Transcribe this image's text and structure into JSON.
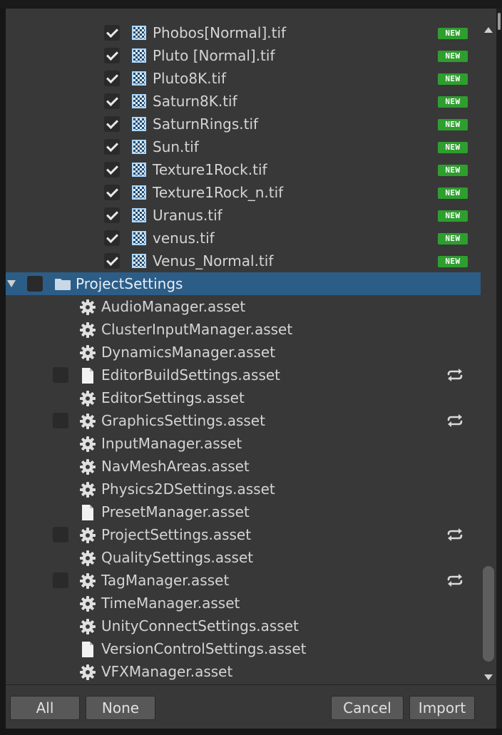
{
  "files_new": [
    {
      "label": "Phobos[Normal].tif",
      "checked": true
    },
    {
      "label": "Pluto [Normal].tif",
      "checked": true
    },
    {
      "label": "Pluto8K.tif",
      "checked": true
    },
    {
      "label": "Saturn8K.tif",
      "checked": true
    },
    {
      "label": "SaturnRings.tif",
      "checked": true
    },
    {
      "label": "Sun.tif",
      "checked": true
    },
    {
      "label": "Texture1Rock.tif",
      "checked": true
    },
    {
      "label": "Texture1Rock_n.tif",
      "checked": true
    },
    {
      "label": "Uranus.tif",
      "checked": true
    },
    {
      "label": "venus.tif",
      "checked": true
    },
    {
      "label": "Venus_Normal.tif",
      "checked": true
    }
  ],
  "badge_label": "NEW",
  "folder": {
    "label": "ProjectSettings",
    "checked": false,
    "expanded": true
  },
  "settings_items": [
    {
      "label": "AudioManager.asset",
      "icon": "gear-icon",
      "has_checkbox": false,
      "changed": false
    },
    {
      "label": "ClusterInputManager.asset",
      "icon": "gear-icon",
      "has_checkbox": false,
      "changed": false
    },
    {
      "label": "DynamicsManager.asset",
      "icon": "gear-icon",
      "has_checkbox": false,
      "changed": false
    },
    {
      "label": "EditorBuildSettings.asset",
      "icon": "document-icon",
      "has_checkbox": true,
      "changed": true
    },
    {
      "label": "EditorSettings.asset",
      "icon": "gear-icon",
      "has_checkbox": false,
      "changed": false
    },
    {
      "label": "GraphicsSettings.asset",
      "icon": "gear-icon",
      "has_checkbox": true,
      "changed": true
    },
    {
      "label": "InputManager.asset",
      "icon": "gear-icon",
      "has_checkbox": false,
      "changed": false
    },
    {
      "label": "NavMeshAreas.asset",
      "icon": "gear-icon",
      "has_checkbox": false,
      "changed": false
    },
    {
      "label": "Physics2DSettings.asset",
      "icon": "gear-icon",
      "has_checkbox": false,
      "changed": false
    },
    {
      "label": "PresetManager.asset",
      "icon": "document-icon",
      "has_checkbox": false,
      "changed": false
    },
    {
      "label": "ProjectSettings.asset",
      "icon": "gear-icon",
      "has_checkbox": true,
      "changed": true
    },
    {
      "label": "QualitySettings.asset",
      "icon": "gear-icon",
      "has_checkbox": false,
      "changed": false
    },
    {
      "label": "TagManager.asset",
      "icon": "gear-icon",
      "has_checkbox": true,
      "changed": true
    },
    {
      "label": "TimeManager.asset",
      "icon": "gear-icon",
      "has_checkbox": false,
      "changed": false
    },
    {
      "label": "UnityConnectSettings.asset",
      "icon": "gear-icon",
      "has_checkbox": false,
      "changed": false
    },
    {
      "label": "VersionControlSettings.asset",
      "icon": "document-icon",
      "has_checkbox": false,
      "changed": false
    },
    {
      "label": "VFXManager.asset",
      "icon": "gear-icon",
      "has_checkbox": false,
      "changed": false
    }
  ],
  "buttons": {
    "all": "All",
    "none": "None",
    "cancel": "Cancel",
    "import": "Import"
  },
  "colors": {
    "panel_bg": "#383838",
    "selection": "#2c5d87",
    "new_badge": "#2e9e2e",
    "text": "#d4d4d4"
  },
  "scrollbar": {
    "position_fraction": 0.88
  }
}
